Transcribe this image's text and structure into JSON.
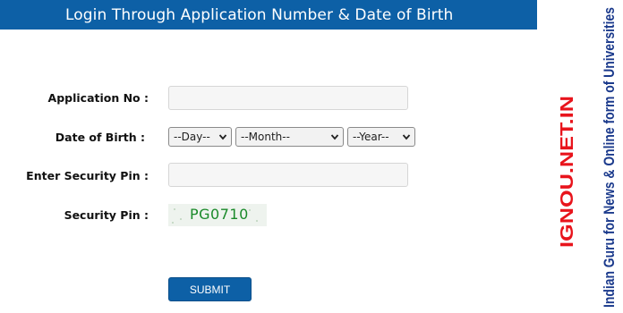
{
  "header": {
    "title": "Login Through Application Number & Date of Birth"
  },
  "form": {
    "application_no_label": "Application No :",
    "application_no_value": "",
    "dob_label": "Date of Birth :",
    "day_selected": "--Day--",
    "month_selected": "--Month--",
    "year_selected": "--Year--",
    "enter_pin_label": "Enter Security Pin :",
    "enter_pin_value": "",
    "security_pin_label": "Security Pin :",
    "captcha_text": "PG0710",
    "submit_label": "SUBMIT"
  },
  "watermark": {
    "site": "IGNOU.NET.IN",
    "tagline": "Indian Guru for News & Online form of Universities"
  },
  "colors": {
    "header_bg": "#0d60a6",
    "button_bg": "#0d60a6",
    "captcha_text": "#1a8a2a",
    "watermark_red": "#e8141c",
    "watermark_blue": "#1b3a8c"
  }
}
